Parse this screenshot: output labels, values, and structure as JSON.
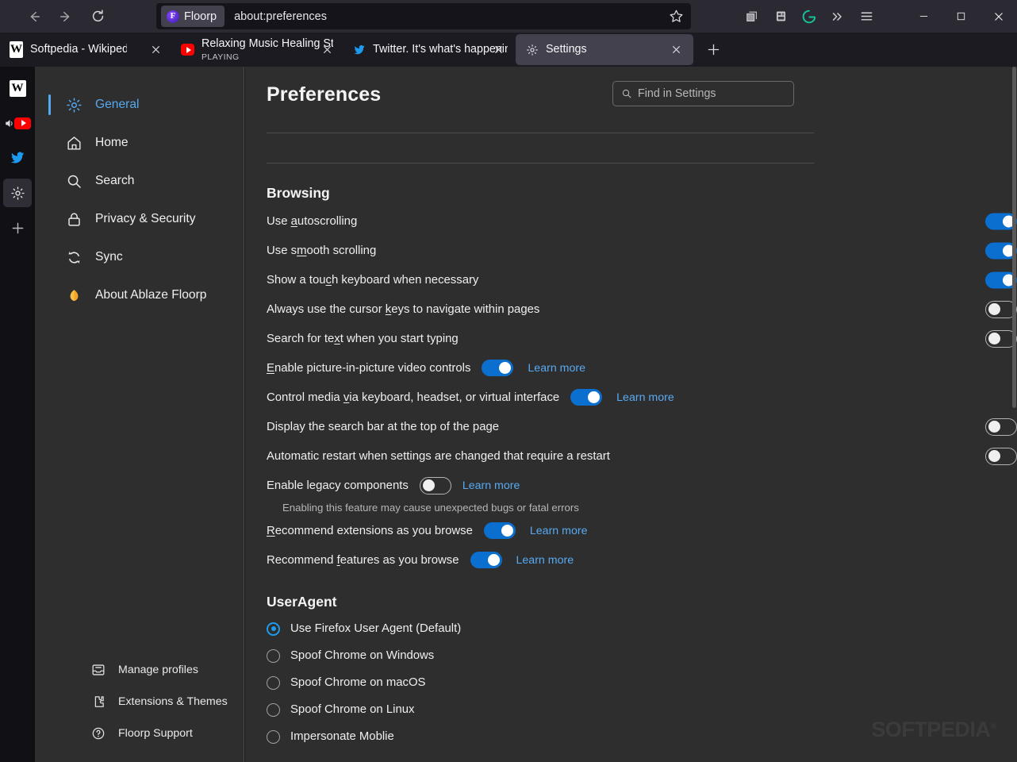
{
  "window": {
    "accent_blue": "#0b6fd0",
    "link_blue": "#57aaf2",
    "selected_blue": "#55a9f0",
    "chrome_bg": "#2b2a33",
    "tabbar_bg": "#1c1b22",
    "content_bg": "#2e2e2e"
  },
  "navbar": {
    "back_icon": "back-arrow-icon",
    "forward_icon": "forward-arrow-icon",
    "reload_icon": "reload-icon",
    "identity_badge": "Floorp",
    "url": "about:preferences",
    "bookmark_icon": "star-icon",
    "toolbar_icons": [
      "container-tabs-icon",
      "save-page-icon",
      "grammarly-icon",
      "overflow-chevrons-icon",
      "app-menu-icon"
    ],
    "window_controls": [
      "minimize-icon",
      "maximize-icon",
      "close-icon"
    ]
  },
  "tabs": [
    {
      "title": "Softpedia - Wikipedia",
      "subtitle": "",
      "favicon": "wikipedia-icon",
      "active": false
    },
    {
      "title": "Relaxing Music Healing Stress, A",
      "subtitle": "PLAYING",
      "favicon": "youtube-icon",
      "active": false
    },
    {
      "title": "Twitter. It's what's happening / T",
      "subtitle": "",
      "favicon": "twitter-icon",
      "active": false
    },
    {
      "title": "Settings",
      "subtitle": "",
      "favicon": "gear-icon",
      "active": true
    }
  ],
  "new_tab_label": "+",
  "appbar": {
    "items": [
      {
        "name": "wikipedia",
        "glyph": "W",
        "selected": false
      },
      {
        "name": "youtube-playing",
        "glyph": "",
        "selected": false
      },
      {
        "name": "twitter",
        "glyph": "",
        "selected": false
      },
      {
        "name": "settings",
        "glyph": "",
        "selected": true
      },
      {
        "name": "add",
        "glyph": "+",
        "selected": false
      }
    ]
  },
  "sidebar": {
    "categories": [
      {
        "label": "General",
        "icon": "gear-icon",
        "selected": true
      },
      {
        "label": "Home",
        "icon": "home-icon",
        "selected": false
      },
      {
        "label": "Search",
        "icon": "search-icon",
        "selected": false
      },
      {
        "label": "Privacy & Security",
        "icon": "lock-icon",
        "selected": false
      },
      {
        "label": "Sync",
        "icon": "sync-icon",
        "selected": false
      },
      {
        "label": "About Ablaze Floorp",
        "icon": "floorp-leaf-icon",
        "selected": false
      }
    ],
    "bottom_links": [
      {
        "label": "Manage profiles",
        "icon": "profiles-icon"
      },
      {
        "label": "Extensions & Themes",
        "icon": "extensions-icon"
      },
      {
        "label": "Floorp Support",
        "icon": "help-circle-icon"
      }
    ]
  },
  "main": {
    "page_title": "Preferences",
    "search": {
      "placeholder": "Find in Settings",
      "value": "",
      "icon": "search-icon"
    },
    "browsing": {
      "heading": "Browsing",
      "rows": [
        {
          "label": "Use autoscrolling",
          "accesskey": "a",
          "toggle": "on",
          "position": "right",
          "learn_more": null
        },
        {
          "label": "Use smooth scrolling",
          "accesskey": "m",
          "toggle": "on",
          "position": "right",
          "learn_more": null
        },
        {
          "label": "Show a touch keyboard when necessary",
          "accesskey": "c",
          "toggle": "on",
          "position": "right",
          "learn_more": null
        },
        {
          "label": "Always use the cursor keys to navigate within pages",
          "accesskey": "k",
          "toggle": "off",
          "position": "right",
          "learn_more": null
        },
        {
          "label": "Search for text when you start typing",
          "accesskey": "x",
          "toggle": "off",
          "position": "right",
          "learn_more": null
        },
        {
          "label": "Enable picture-in-picture video controls",
          "accesskey": "E",
          "toggle": "on",
          "position": "inline",
          "learn_more": "Learn more"
        },
        {
          "label": "Control media via keyboard, headset, or virtual interface",
          "accesskey": "v",
          "toggle": "on",
          "position": "inline",
          "learn_more": "Learn more"
        },
        {
          "label": "Display the search bar at the top of the page",
          "accesskey": "",
          "toggle": "off",
          "position": "right",
          "learn_more": null
        },
        {
          "label": "Automatic restart when settings are changed that require a restart",
          "accesskey": "",
          "toggle": "off",
          "position": "right",
          "learn_more": null
        },
        {
          "label": "Enable legacy components",
          "accesskey": "",
          "toggle": "off",
          "position": "inline",
          "learn_more": "Learn more",
          "hint": "Enabling this feature may cause unexpected bugs or fatal errors"
        },
        {
          "label": "Recommend extensions as you browse",
          "accesskey": "R",
          "toggle": "on",
          "position": "inline",
          "learn_more": "Learn more"
        },
        {
          "label": "Recommend features as you browse",
          "accesskey": "f",
          "toggle": "on",
          "position": "inline",
          "learn_more": "Learn more"
        }
      ]
    },
    "useragent": {
      "heading": "UserAgent",
      "options": [
        {
          "label": "Use Firefox User Agent (Default)",
          "checked": true
        },
        {
          "label": "Spoof Chrome on Windows",
          "checked": false
        },
        {
          "label": "Spoof Chrome on macOS",
          "checked": false
        },
        {
          "label": "Spoof Chrome on Linux",
          "checked": false
        },
        {
          "label": "Impersonate Moblie",
          "checked": false
        }
      ]
    }
  },
  "watermark": {
    "text": "SOFTPEDIA",
    "mark": "®"
  }
}
